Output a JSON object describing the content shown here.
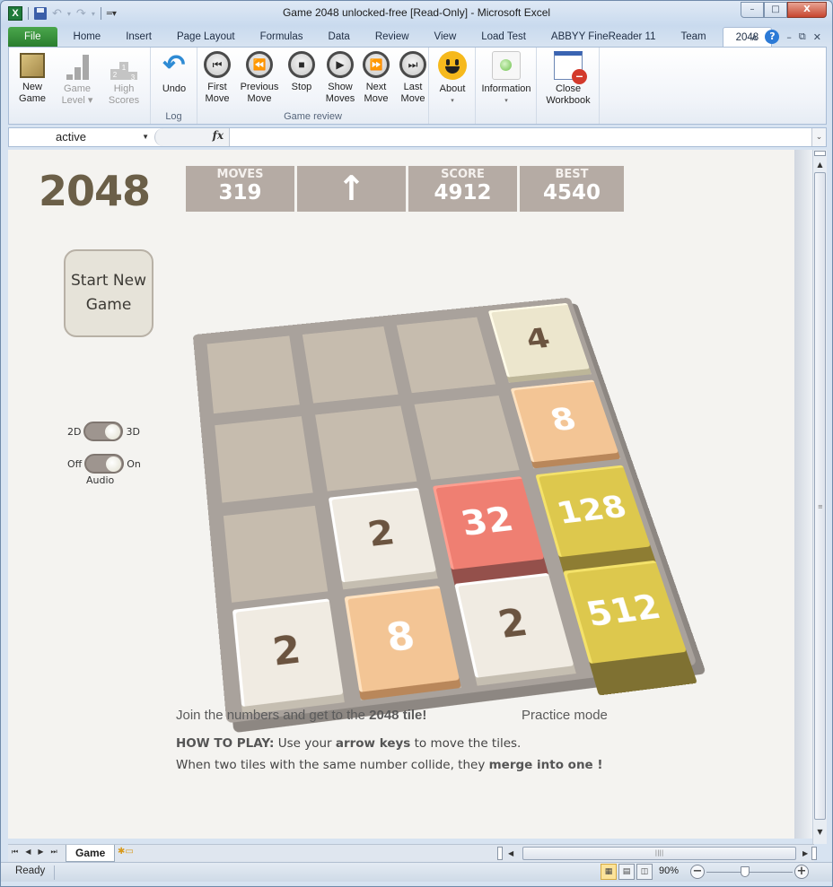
{
  "window": {
    "title": "Game 2048 unlocked-free  [Read-Only]  -  Microsoft Excel",
    "app_icon": "X",
    "controls": {
      "minimize": "–",
      "maximize": "□",
      "close": "X"
    }
  },
  "qat": {
    "save": "save-icon",
    "undo": "↶",
    "redo": "↷",
    "dropdown": "▾",
    "customize": "═▾"
  },
  "tabs": [
    {
      "label": "File"
    },
    {
      "label": "Home"
    },
    {
      "label": "Insert"
    },
    {
      "label": "Page Layout"
    },
    {
      "label": "Formulas"
    },
    {
      "label": "Data"
    },
    {
      "label": "Review"
    },
    {
      "label": "View"
    },
    {
      "label": "Load Test"
    },
    {
      "label": "ABBYY FineReader 11"
    },
    {
      "label": "Team"
    },
    {
      "label": "2048",
      "active": true
    }
  ],
  "tab_right": {
    "collapse": "∧",
    "help": "?",
    "minimize": "–",
    "restore": "⧉",
    "close": "✕"
  },
  "ribbon": {
    "groups": [
      {
        "label": "",
        "buttons": [
          {
            "label1": "New",
            "label2": "Game",
            "icon": "new-game-icon",
            "disabled": false
          },
          {
            "label1": "Game",
            "label2": "Level ▾",
            "icon": "game-level-icon",
            "disabled": true
          },
          {
            "label1": "High",
            "label2": "Scores",
            "icon": "high-scores-icon",
            "disabled": true
          }
        ]
      },
      {
        "label": "Log",
        "buttons": [
          {
            "label1": "Undo",
            "label2": "",
            "icon": "undo-icon"
          }
        ]
      },
      {
        "label": "Game review",
        "buttons": [
          {
            "label1": "First",
            "label2": "Move",
            "glyph": "⏮"
          },
          {
            "label1": "Previous",
            "label2": "Move",
            "glyph": "⏪"
          },
          {
            "label1": "Stop",
            "label2": "",
            "glyph": "■"
          },
          {
            "label1": "Show",
            "label2": "Moves",
            "glyph": "▶"
          },
          {
            "label1": "Next",
            "label2": "Move",
            "glyph": "⏩"
          },
          {
            "label1": "Last",
            "label2": "Move",
            "glyph": "⏭"
          }
        ]
      },
      {
        "label": "",
        "buttons": [
          {
            "label1": "About",
            "label2": "▾",
            "icon": "smiley-icon"
          }
        ]
      },
      {
        "label": "",
        "buttons": [
          {
            "label1": "Information",
            "label2": "▾",
            "icon": "information-icon"
          }
        ]
      },
      {
        "label": "",
        "buttons": [
          {
            "label1": "Close",
            "label2": "Workbook",
            "icon": "close-workbook-icon"
          }
        ]
      }
    ]
  },
  "formula_bar": {
    "name_box": "active",
    "fx": "fx",
    "formula": ""
  },
  "game": {
    "title": "2048",
    "stats": {
      "moves_label": "MOVES",
      "moves": "319",
      "direction": "↑",
      "score_label": "SCORE",
      "score": "4912",
      "best_label": "BEST",
      "best": "4540"
    },
    "start_button": "Start New Game",
    "toggles": {
      "view_left": "2D",
      "view_right": "3D",
      "view_state": "3D",
      "audio_left": "Off",
      "audio_right": "On",
      "audio_state": "On",
      "audio_label": "Audio"
    },
    "board": [
      [
        null,
        null,
        null,
        4
      ],
      [
        null,
        null,
        null,
        8
      ],
      [
        null,
        2,
        32,
        128
      ],
      [
        2,
        8,
        2,
        512
      ]
    ],
    "tile_colors": {
      "2": "#f0ebe2",
      "4": "#ece6cd",
      "8": "#f3c595",
      "32": "#ef7f72",
      "128": "#ddc84d",
      "512": "#ddc84d"
    },
    "intro_text_pre": "Join the numbers and get to the ",
    "intro_text_bold": "2048 tile!",
    "mode": "Practice mode",
    "howto_bold": "HOW TO PLAY:",
    "howto_1": " Use your ",
    "howto_keys": "arrow keys",
    "howto_2": " to move the tiles.",
    "howto_line2": "When two tiles with the same number collide, they ",
    "howto_merge": "merge into one !"
  },
  "sheet_tabs": {
    "active": "Game",
    "new_sheet": "new-sheet-icon"
  },
  "status": {
    "text": "Ready",
    "zoom": "90%",
    "zoom_value_percent": 90
  }
}
